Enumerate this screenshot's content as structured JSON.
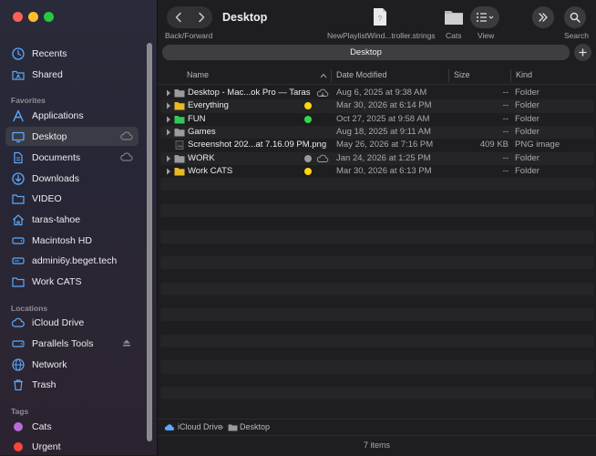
{
  "window": {
    "title": "Desktop"
  },
  "toolbar": {
    "nav_caption": "Back/Forward",
    "file_caption": "NewPlaylistWind...troller.strings",
    "cats_caption": "Cats",
    "view_caption": "View",
    "search_caption": "Search"
  },
  "tabs": [
    {
      "label": "Desktop",
      "active": true
    }
  ],
  "sidebar": {
    "items_top": [
      {
        "label": "Recents",
        "icon": "clock-icon"
      },
      {
        "label": "Shared",
        "icon": "shared-folder-icon"
      }
    ],
    "favorites_header": "Favorites",
    "favorites": [
      {
        "label": "Applications",
        "icon": "applications-icon"
      },
      {
        "label": "Desktop",
        "icon": "desktop-icon",
        "selected": true,
        "trailing": "cloud-icon"
      },
      {
        "label": "Documents",
        "icon": "document-icon",
        "trailing": "cloud-icon"
      },
      {
        "label": "Downloads",
        "icon": "download-icon"
      },
      {
        "label": "VIDEO",
        "icon": "folder-icon"
      },
      {
        "label": "taras-tahoe",
        "icon": "home-icon"
      },
      {
        "label": "Macintosh HD",
        "icon": "drive-icon"
      },
      {
        "label": "admini6y.beget.tech",
        "icon": "server-drive-icon"
      },
      {
        "label": "Work CATS",
        "icon": "folder-icon"
      }
    ],
    "locations_header": "Locations",
    "locations": [
      {
        "label": "iCloud Drive",
        "icon": "cloud-icon"
      },
      {
        "label": "Parallels Tools",
        "icon": "drive-icon",
        "trailing": "eject-icon"
      },
      {
        "label": "Network",
        "icon": "globe-icon"
      },
      {
        "label": "Trash",
        "icon": "trash-icon"
      }
    ],
    "tags_header": "Tags",
    "tags": [
      {
        "label": "Cats",
        "color": "#b86bd8"
      },
      {
        "label": "Urgent",
        "color": "#ff453a"
      }
    ]
  },
  "list": {
    "columns": {
      "name": "Name",
      "date": "Date Modified",
      "size": "Size",
      "kind": "Kind"
    },
    "rows": [
      {
        "name": "Desktop - Mac...ok Pro — Taras",
        "date": "Aug 6, 2025 at 9:38 AM",
        "size": "--",
        "kind": "Folder",
        "icon": "gray-folder-icon",
        "expandable": true,
        "status": "cloud-download-icon"
      },
      {
        "name": "Everything",
        "date": "Mar 30, 2026 at 6:14 PM",
        "size": "--",
        "kind": "Folder",
        "icon": "yellow-folder-icon",
        "expandable": true,
        "tag": "#ffd60a"
      },
      {
        "name": "FUN",
        "date": "Oct 27, 2025 at 9:58 AM",
        "size": "--",
        "kind": "Folder",
        "icon": "green-folder-icon",
        "expandable": true,
        "tag": "#32d74b"
      },
      {
        "name": "Games",
        "date": "Aug 18, 2025 at 9:11 AM",
        "size": "--",
        "kind": "Folder",
        "icon": "gray-folder-icon",
        "expandable": true
      },
      {
        "name": "Screenshot 202...at 7.16.09 PM.png",
        "date": "May 26, 2026 at 7:16 PM",
        "size": "409 KB",
        "kind": "PNG image",
        "icon": "image-file-icon",
        "expandable": false
      },
      {
        "name": "WORK",
        "date": "Jan 24, 2026 at 1:25 PM",
        "size": "--",
        "kind": "Folder",
        "icon": "gray-folder-icon",
        "expandable": true,
        "tag": "#98989d",
        "status": "cloud-icon"
      },
      {
        "name": "Work CATS",
        "date": "Mar 30, 2026 at 6:13 PM",
        "size": "--",
        "kind": "Folder",
        "icon": "yellow-folder-icon",
        "expandable": true,
        "tag": "#ffd60a"
      }
    ]
  },
  "pathbar": {
    "root": "iCloud Drive",
    "current": "Desktop"
  },
  "status": {
    "items": "7 items"
  },
  "colors": {
    "accent": "#0a84ff",
    "yellow_folder": "#e8b828",
    "green_folder": "#34c759"
  }
}
